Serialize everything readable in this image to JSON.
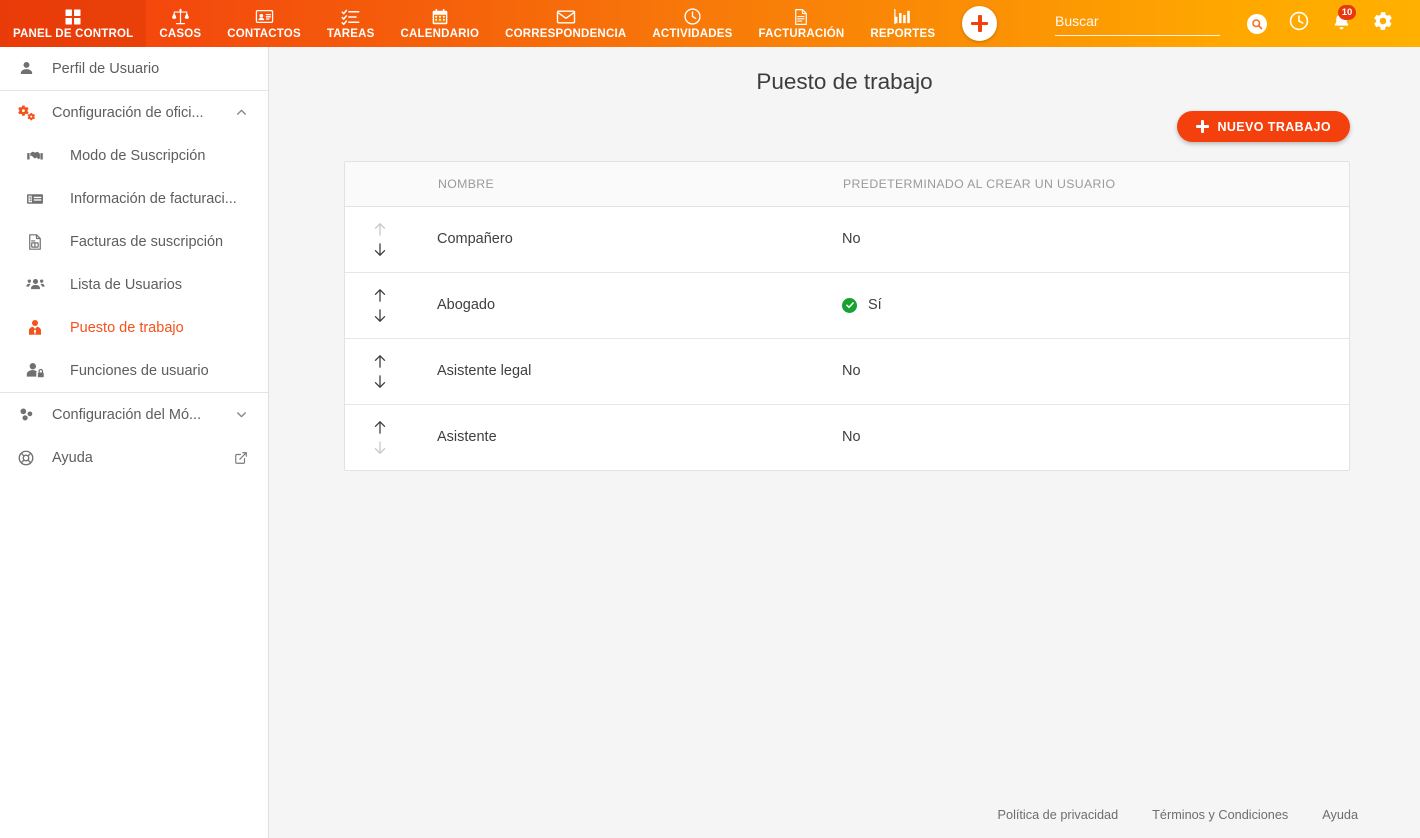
{
  "topnav": {
    "items": [
      {
        "label": "PANEL DE CONTROL",
        "icon": "dashboard-grid-icon",
        "active": true
      },
      {
        "label": "CASOS",
        "icon": "scales-balance-icon",
        "active": false
      },
      {
        "label": "CONTACTOS",
        "icon": "contact-card-icon",
        "active": false
      },
      {
        "label": "TAREAS",
        "icon": "checklist-icon",
        "active": false
      },
      {
        "label": "CALENDARIO",
        "icon": "calendar-icon",
        "active": false
      },
      {
        "label": "CORRESPONDENCIA",
        "icon": "envelope-icon",
        "active": false
      },
      {
        "label": "ACTIVIDADES",
        "icon": "clock-icon",
        "active": false
      },
      {
        "label": "FACTURACIÓN",
        "icon": "invoice-document-icon",
        "active": false
      },
      {
        "label": "REPORTES",
        "icon": "bar-chart-icon",
        "active": false
      }
    ],
    "add_button": "+",
    "search": {
      "value": "",
      "placeholder": "Buscar"
    },
    "notifications_count": "10",
    "colors": {
      "gradient_start": "#f4400c",
      "gradient_end": "#ffb000",
      "badge": "#e8380d"
    }
  },
  "sidebar": {
    "profile": {
      "label": "Perfil de Usuario",
      "icon": "user-icon"
    },
    "office_section": {
      "label": "Configuración de ofici...",
      "icon": "cogs-icon",
      "expanded": true,
      "chevron": "chevron-up-icon",
      "items": [
        {
          "label": "Modo de Suscripción",
          "icon": "handshake-icon",
          "active": false
        },
        {
          "label": "Información de facturaci...",
          "icon": "money-bill-icon",
          "active": false
        },
        {
          "label": "Facturas de suscripción",
          "icon": "file-invoice-icon",
          "active": false
        },
        {
          "label": "Lista de Usuarios",
          "icon": "users-icon",
          "active": false
        },
        {
          "label": "Puesto de trabajo",
          "icon": "user-tie-icon",
          "active": true
        },
        {
          "label": "Funciones de usuario",
          "icon": "user-lock-icon",
          "active": false
        }
      ]
    },
    "module_section": {
      "label": "Configuración del Mó...",
      "icon": "modules-icon",
      "expanded": false,
      "chevron": "chevron-down-icon"
    },
    "help": {
      "label": "Ayuda",
      "icon": "life-ring-icon",
      "external": "external-link-icon"
    },
    "active_color": "#f4521c"
  },
  "main": {
    "title": "Puesto de trabajo",
    "new_button": "NUEVO TRABAJO",
    "table": {
      "headers": {
        "order": "",
        "name": "NOMBRE",
        "default": "PREDETERMINADO AL CREAR UN USUARIO"
      },
      "rows": [
        {
          "name": "Compañero",
          "default": "No",
          "default_yes": false,
          "up_enabled": false,
          "down_enabled": true
        },
        {
          "name": "Abogado",
          "default": "Sí",
          "default_yes": true,
          "up_enabled": true,
          "down_enabled": true
        },
        {
          "name": "Asistente legal",
          "default": "No",
          "default_yes": false,
          "up_enabled": true,
          "down_enabled": true
        },
        {
          "name": "Asistente",
          "default": "No",
          "default_yes": false,
          "up_enabled": true,
          "down_enabled": false
        }
      ]
    }
  },
  "footer": {
    "links": [
      "Política de privacidad",
      "Términos y Condiciones",
      "Ayuda"
    ]
  }
}
